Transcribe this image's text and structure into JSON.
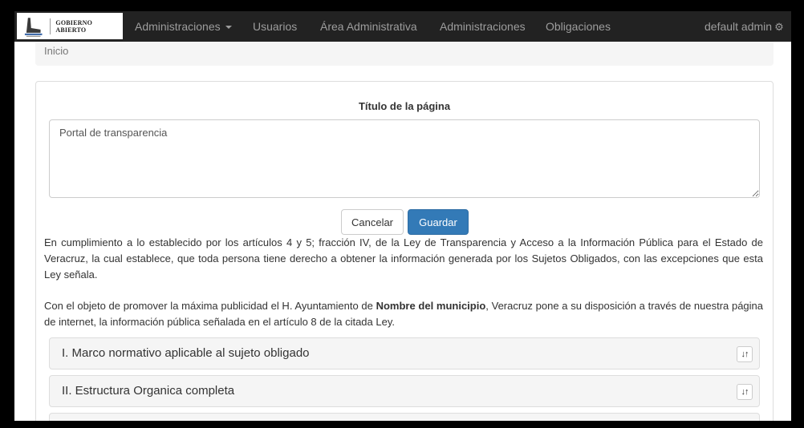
{
  "navbar": {
    "brand_text": "GOBIERNO ABIERTO",
    "items": [
      {
        "label": "Administraciones",
        "dropdown": true
      },
      {
        "label": "Usuarios"
      },
      {
        "label": "Área Administrativa"
      },
      {
        "label": "Administraciones"
      },
      {
        "label": "Obligaciones"
      }
    ],
    "user_label": "default admin",
    "user_icon": "gear-icon"
  },
  "breadcrumb": {
    "current": "Inicio"
  },
  "form": {
    "title_label": "Título de la página",
    "title_value": "Portal de transparencia",
    "cancel_label": "Cancelar",
    "save_label": "Guardar"
  },
  "intro": {
    "paragraph1": "En cumplimiento a lo establecido por los artículos 4 y 5; fracción IV, de la Ley de Transparencia y Acceso a la Información Pública para el Estado de Veracruz, la cual establece, que toda persona tiene derecho a obtener la información generada por los Sujetos Obligados, con las excepciones que esta Ley señala.",
    "paragraph2_before": "Con el objeto de promover la máxima publicidad el H. Ayuntamiento de ",
    "paragraph2_bold": "Nombre del municipio",
    "paragraph2_after": ", Veracruz pone a su disposición a través de nuestra página de internet, la información pública señalada en el artículo 8 de la citada Ley."
  },
  "obligations": [
    {
      "title": "I. Marco normativo aplicable al sujeto obligado",
      "sort_icon": "sort-icon"
    },
    {
      "title": "II. Estructura Organica completa",
      "sort_icon": "sort-icon"
    },
    {
      "title": "",
      "sort_icon": "sort-icon"
    }
  ],
  "colors": {
    "navbar_bg": "#222222",
    "nav_text": "#9d9d9d",
    "primary": "#337ab7"
  }
}
